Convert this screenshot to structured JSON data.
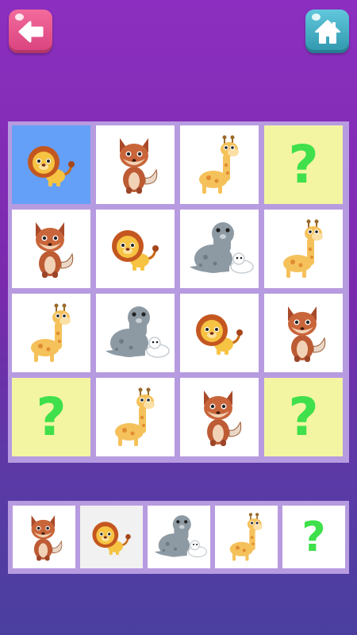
{
  "toolbar": {
    "back_icon": "back-arrow-icon",
    "home_icon": "home-icon",
    "back_color": "#e8518a",
    "home_color": "#45b4cb"
  },
  "board": {
    "size": 4,
    "cells": [
      [
        "lion",
        "fox",
        "giraffe",
        "unknown"
      ],
      [
        "fox",
        "lion",
        "seal",
        "giraffe"
      ],
      [
        "giraffe",
        "seal",
        "lion",
        "fox"
      ],
      [
        "unknown",
        "giraffe",
        "fox",
        "unknown"
      ]
    ],
    "selected": {
      "row": 0,
      "col": 0
    },
    "unknown_glyph": "?"
  },
  "palette": {
    "items": [
      "fox",
      "lion",
      "seal",
      "giraffe",
      "unknown"
    ],
    "dimmed": "lion"
  },
  "colors": {
    "selected": "#649ff8",
    "unknown_bg": "#f4f5a3",
    "question_mark": "#3fe04b"
  }
}
